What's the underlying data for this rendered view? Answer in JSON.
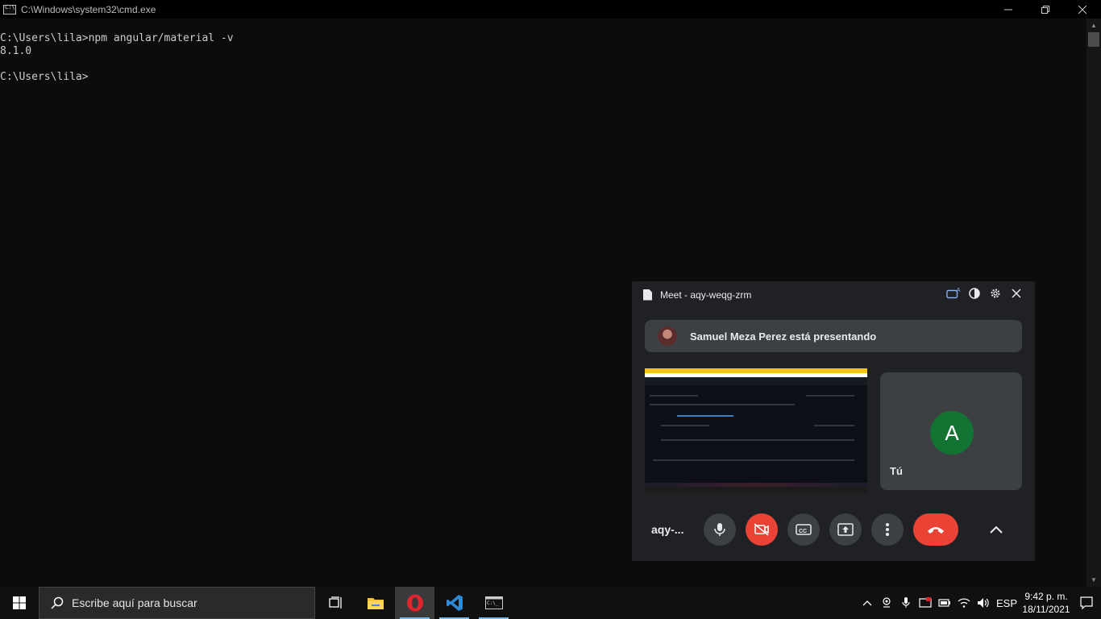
{
  "window": {
    "title": "C:\\Windows\\system32\\cmd.exe",
    "minimize": "—",
    "maximize": "❐",
    "close": "✕"
  },
  "console": {
    "lines": [
      "C:\\Users\\lila>npm angular/material -v",
      "8.1.0",
      "",
      "C:\\Users\\lila>"
    ]
  },
  "meet": {
    "title": "Meet - aqy-weqg-zrm",
    "presenting_text": "Samuel Meza Perez está presentando",
    "self_initial": "A",
    "self_label": "Tú",
    "meeting_code": "aqy-...",
    "accent_colors": {
      "end_call": "#ea4335",
      "avatar": "#137333",
      "tile": "#3c4043"
    }
  },
  "taskbar": {
    "search_placeholder": "Escribe aquí para buscar",
    "language": "ESP",
    "time": "9:42 p. m.",
    "date": "18/11/2021"
  }
}
